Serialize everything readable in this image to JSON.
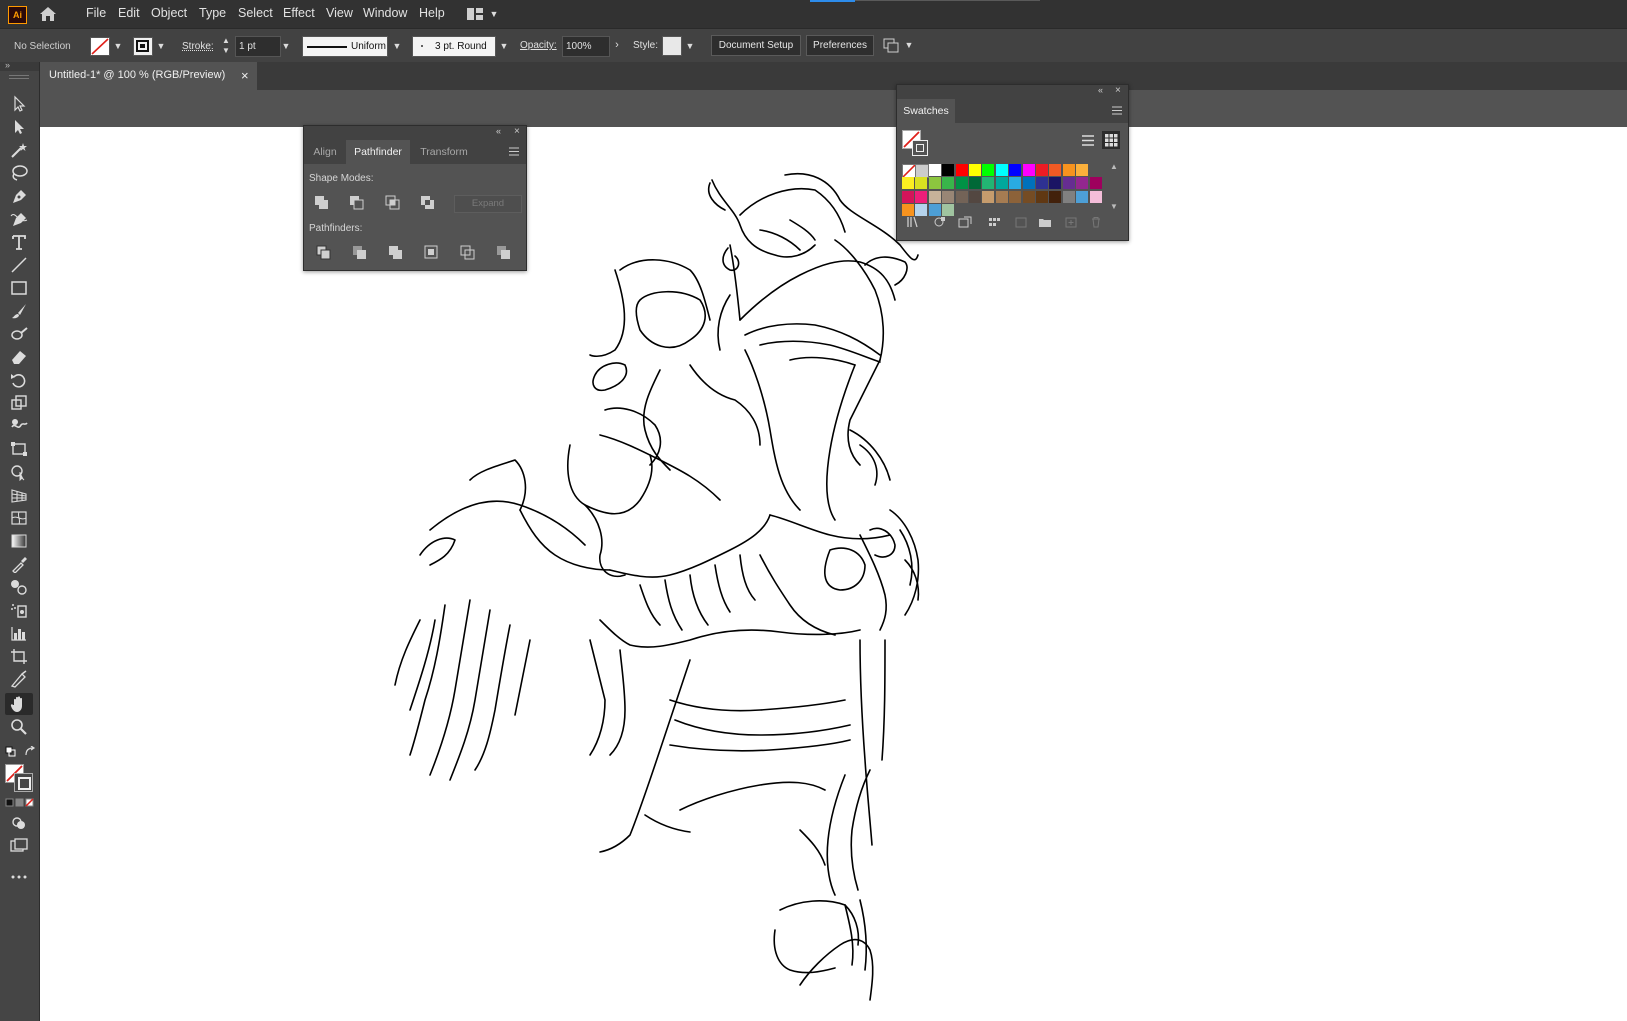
{
  "app": {
    "logo": "Ai"
  },
  "menu": [
    "File",
    "Edit",
    "Object",
    "Type",
    "Select",
    "Effect",
    "View",
    "Window",
    "Help"
  ],
  "control": {
    "selection": "No Selection",
    "stroke_label": "Stroke:",
    "stroke_weight": "1 pt",
    "profile": "Uniform",
    "brush": "3 pt. Round",
    "opacity_label": "Opacity:",
    "opacity": "100%",
    "style_label": "Style:",
    "document_setup": "Document Setup",
    "preferences": "Preferences"
  },
  "document_tab": {
    "title": "Untitled-1* @ 100 % (RGB/Preview)",
    "close": "×"
  },
  "pathfinder_panel": {
    "tabs": [
      "Align",
      "Pathfinder",
      "Transform"
    ],
    "active_tab": "Pathfinder",
    "shape_modes_label": "Shape Modes:",
    "expand_label": "Expand",
    "pathfinders_label": "Pathfinders:"
  },
  "swatches_panel": {
    "title": "Swatches",
    "colors_row1": [
      "#ffffff",
      "#000000",
      "#ff0000",
      "#ffff00",
      "#00ff00",
      "#00ffff",
      "#0000ff",
      "#ff00ff",
      "#ed1c24",
      "#f15a24",
      "#f7931e",
      "#fbb03b"
    ],
    "colors_row2": [
      "#fcee21",
      "#d9e021",
      "#8cc63f",
      "#39b54a",
      "#009245",
      "#006837",
      "#22b573",
      "#00a99d",
      "#29abe2",
      "#0071bc",
      "#2e3192",
      "#1b1464",
      "#662d91",
      "#93278f",
      "#9e005d"
    ],
    "colors_row3": [
      "#d4145a",
      "#ed1e79",
      "#c7b299",
      "#998675",
      "#736357",
      "#534741",
      "#c69c6d",
      "#a67c52",
      "#8c6239",
      "#754c24",
      "#603813",
      "#42210b",
      "#808080",
      "#4d9fd6",
      "#f4bdd9"
    ],
    "colors_row4": [
      "#f7931e",
      "#b5d3ec",
      "#4d9fd6",
      "#a0c4a0"
    ]
  }
}
